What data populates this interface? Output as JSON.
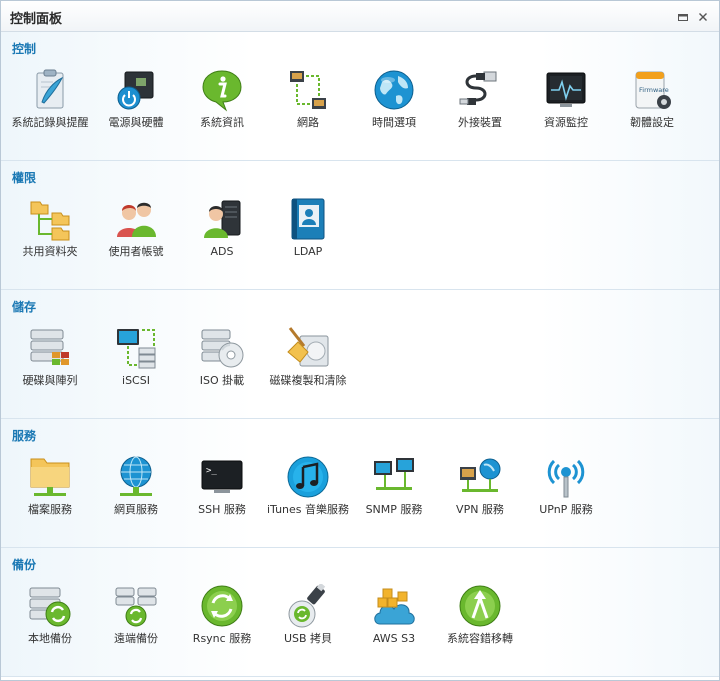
{
  "window": {
    "title": "控制面板",
    "restore_icon": "restore-icon",
    "close_icon": "close-icon"
  },
  "colors": {
    "section_title": "#1a78b4",
    "label": "#333333",
    "accent": "#2aa0d8",
    "green": "#6ab82e"
  },
  "sections": [
    {
      "title": "控制",
      "items": [
        {
          "label": "系統記錄與提醒",
          "icon": "clipboard-icon"
        },
        {
          "label": "電源與硬體",
          "icon": "power-hardware-icon"
        },
        {
          "label": "系統資訊",
          "icon": "info-bubble-icon"
        },
        {
          "label": "網路",
          "icon": "network-icon"
        },
        {
          "label": "時間選項",
          "icon": "globe-clock-icon"
        },
        {
          "label": "外接裝置",
          "icon": "usb-cable-icon"
        },
        {
          "label": "資源監控",
          "icon": "monitor-pulse-icon"
        },
        {
          "label": "韌體設定",
          "icon": "firmware-box-icon",
          "icon_text": "Firmware"
        }
      ]
    },
    {
      "title": "權限",
      "items": [
        {
          "label": "共用資料夾",
          "icon": "shared-folder-icon"
        },
        {
          "label": "使用者帳號",
          "icon": "users-icon"
        },
        {
          "label": "ADS",
          "icon": "ads-server-user-icon"
        },
        {
          "label": "LDAP",
          "icon": "ldap-book-icon"
        }
      ]
    },
    {
      "title": "儲存",
      "items": [
        {
          "label": "硬碟與陣列",
          "icon": "disk-array-icon"
        },
        {
          "label": "iSCSI",
          "icon": "iscsi-icon"
        },
        {
          "label": "ISO 掛載",
          "icon": "iso-mount-icon"
        },
        {
          "label": "磁碟複製和清除",
          "icon": "disk-clean-broom-icon"
        }
      ]
    },
    {
      "title": "服務",
      "items": [
        {
          "label": "檔案服務",
          "icon": "file-service-folder-icon"
        },
        {
          "label": "網頁服務",
          "icon": "web-service-globe-icon"
        },
        {
          "label": "SSH 服務",
          "icon": "terminal-icon",
          "icon_text": ">_"
        },
        {
          "label": "iTunes 音樂服務",
          "icon": "music-note-icon"
        },
        {
          "label": "SNMP 服務",
          "icon": "snmp-monitors-icon"
        },
        {
          "label": "VPN 服務",
          "icon": "vpn-icon"
        },
        {
          "label": "UPnP 服務",
          "icon": "upnp-antenna-icon"
        }
      ]
    },
    {
      "title": "備份",
      "items": [
        {
          "label": "本地備份",
          "icon": "local-backup-icon"
        },
        {
          "label": "遠端備份",
          "icon": "remote-backup-icon"
        },
        {
          "label": "Rsync 服務",
          "icon": "rsync-icon"
        },
        {
          "label": "USB 拷貝",
          "icon": "usb-copy-icon"
        },
        {
          "label": "AWS S3",
          "icon": "aws-s3-cloud-icon"
        },
        {
          "label": "系統容錯移轉",
          "icon": "failover-icon"
        }
      ]
    }
  ]
}
